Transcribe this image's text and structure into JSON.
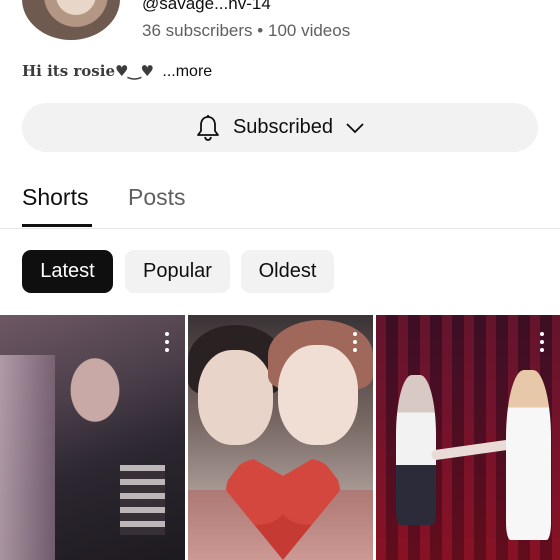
{
  "channel": {
    "handle": "@savage...nv-14",
    "subscribers": "36 subscribers",
    "separator": "•",
    "videos": "100 videos",
    "bio": "Hi its rosie♥‿♥",
    "more_label": "...more"
  },
  "subscribe_button": {
    "label": "Subscribed",
    "bell_icon": "bell-icon",
    "chevron_icon": "chevron-down-icon"
  },
  "tabs": [
    {
      "label": "Shorts",
      "active": true
    },
    {
      "label": "Posts",
      "active": false
    }
  ],
  "filters": [
    {
      "label": "Latest",
      "selected": true
    },
    {
      "label": "Popular",
      "selected": false
    },
    {
      "label": "Oldest",
      "selected": false
    }
  ],
  "shorts": [
    {
      "menu_icon": "more-vert-icon"
    },
    {
      "menu_icon": "more-vert-icon"
    },
    {
      "menu_icon": "more-vert-icon"
    }
  ],
  "colors": {
    "chip_selected_bg": "#0f0f0f",
    "chip_bg": "#f2f2f2",
    "secondary_text": "#606060"
  }
}
